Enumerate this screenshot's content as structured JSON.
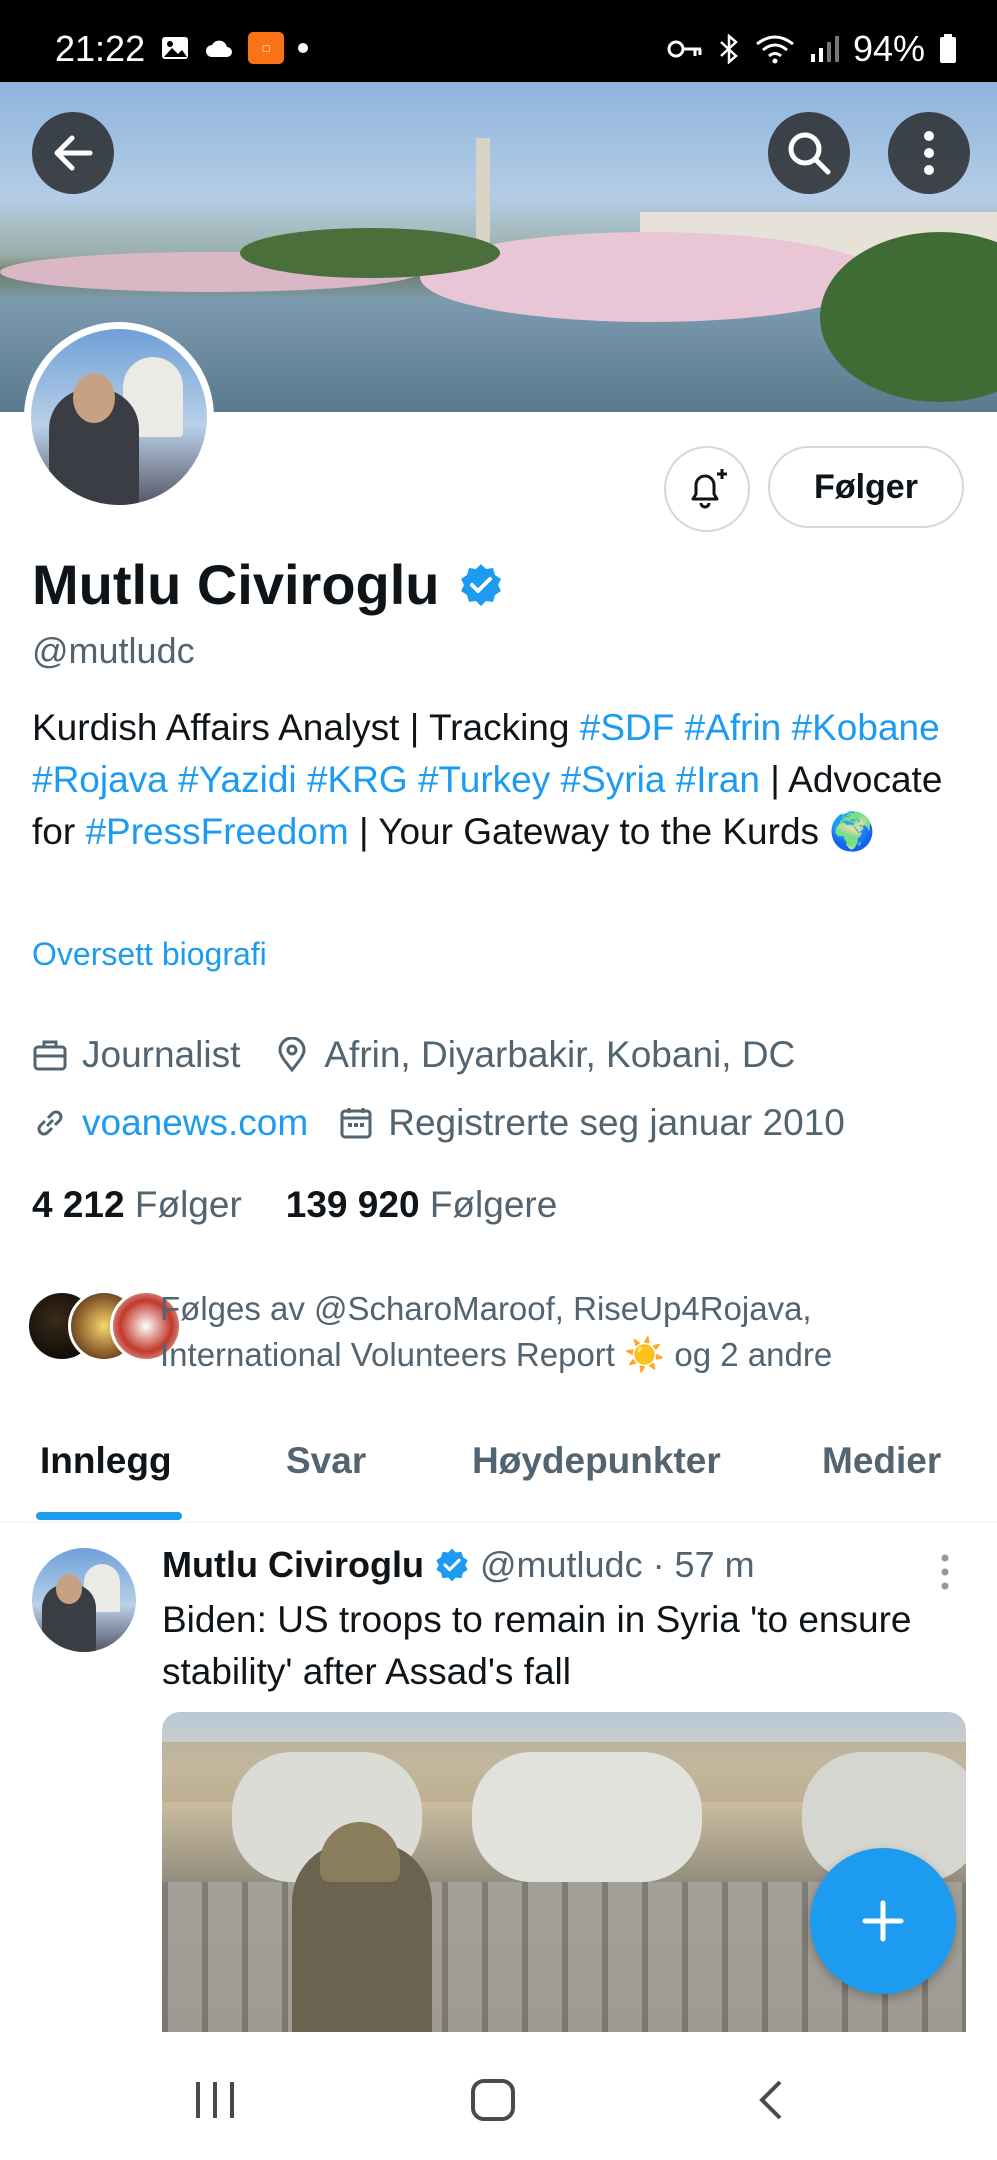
{
  "status_bar": {
    "time": "21:22",
    "battery": "94%"
  },
  "profile": {
    "name": "Mutlu Civiroglu",
    "handle": "@mutludc",
    "follow_button": "Følger",
    "bio": {
      "part1": "Kurdish Affairs Analyst | Tracking ",
      "tags1": "#SDF #Afrin #Kobane #Rojava #Yazidi #KRG #Turkey #Syria #Iran",
      "part2": " | Advocate for ",
      "tag2": "#PressFreedom",
      "part3": " | Your Gateway to the Kurds 🌍"
    },
    "translate_link": "Oversett biografi",
    "profession": "Journalist",
    "location": "Afrin, Diyarbakir, Kobani, DC",
    "website": "voanews.com",
    "joined": "Registrerte seg januar 2010",
    "following_count": "4 212",
    "following_label": "Følger",
    "followers_count": "139 920",
    "followers_label": "Følgere",
    "followed_by": "Følges av @ScharoMaroof, RiseUp4Rojava, International Volunteers Report ☀️ og 2 andre"
  },
  "tabs": [
    {
      "label": "Innlegg",
      "active": true
    },
    {
      "label": "Svar",
      "active": false
    },
    {
      "label": "Høydepunkter",
      "active": false
    },
    {
      "label": "Medier",
      "active": false
    }
  ],
  "tweet": {
    "author": "Mutlu Civiroglu",
    "handle_time": "@mutludc · 57 m",
    "text": "Biden: US troops to remain in Syria 'to ensure stability' after Assad's fall"
  },
  "colors": {
    "accent": "#1d9bf0",
    "secondary_text": "#536471",
    "primary_text": "#0f1419"
  },
  "icons": {
    "back": "arrow-left-icon",
    "search": "search-icon",
    "more": "more-vertical-icon",
    "notify": "bell-plus-icon",
    "verified": "verified-badge-icon",
    "profession": "briefcase-icon",
    "location": "location-pin-icon",
    "website": "link-icon",
    "joined": "calendar-icon",
    "compose": "plus-icon"
  }
}
